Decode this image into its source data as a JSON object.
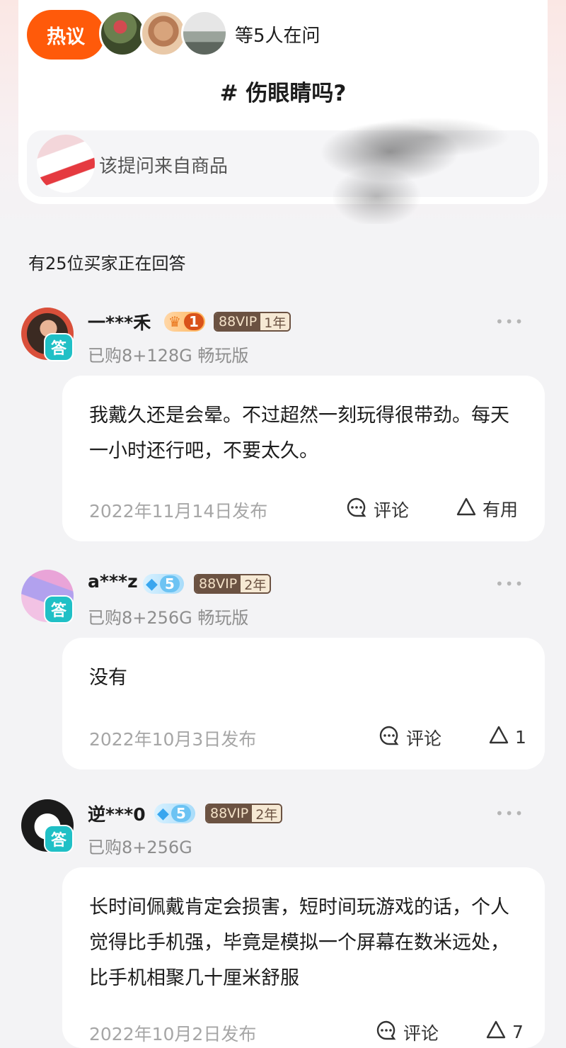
{
  "question": {
    "hot_label": "热议",
    "askers_text": "等5人在问",
    "title": "# 伤眼睛吗?",
    "source_text": "该提问来自商品"
  },
  "answers_header": "有25位买家正在回答",
  "answers": [
    {
      "name": "一***禾",
      "level": "1",
      "vip": "88VIP",
      "vip_years": "1年",
      "purchase": "已购8+128G 畅玩版",
      "badge": "答",
      "text": "我戴久还是会晕。不过超然一刻玩得很带劲。每天一小时还行吧，不要太久。",
      "date": "2022年11月14日发布",
      "comment_label": "评论",
      "useful_label": "有用"
    },
    {
      "name": "a***z",
      "level": "5",
      "vip": "88VIP",
      "vip_years": "2年",
      "purchase": "已购8+256G 畅玩版",
      "badge": "答",
      "text": "没有",
      "date": "2022年10月3日发布",
      "comment_label": "评论",
      "useful_label": "1"
    },
    {
      "name": "逆***0",
      "level": "5",
      "vip": "88VIP",
      "vip_years": "2年",
      "purchase": "已购8+256G",
      "badge": "答",
      "text": "长时间佩戴肯定会损害，短时间玩游戏的话，个人觉得比手机强，毕竟是模拟一个屏幕在数米远处，比手机相聚几十厘米舒服",
      "date": "2022年10月2日发布",
      "comment_label": "评论",
      "useful_label": "7"
    }
  ]
}
